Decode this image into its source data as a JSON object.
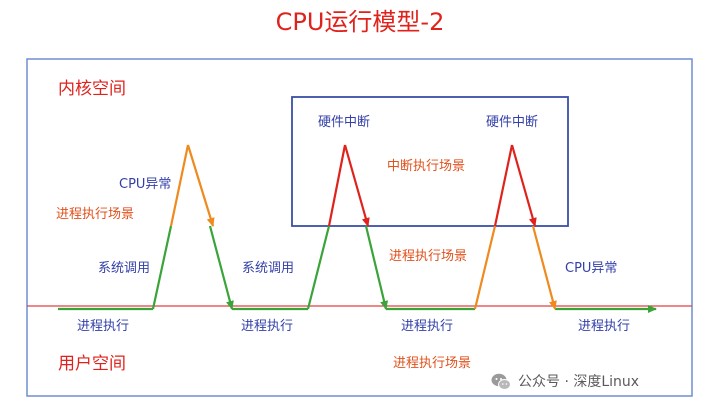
{
  "title": "CPU运行模型-2",
  "colors": {
    "title": "#e0221c",
    "region_label": "#e0221c",
    "frame": "#6f8fd0",
    "interrupt_box": "#3a4fa8",
    "baseline": "#e04040",
    "blue_text": "#3340a8",
    "orange_text": "#e0511c",
    "green_line": "#3aa33a",
    "orange_line": "#ef8a1e",
    "red_line": "#e0221c"
  },
  "regions": {
    "kernel": "内核空间",
    "user": "用户空间"
  },
  "labels": {
    "cpu_exception_left": "CPU异常",
    "process_scene_left": "进程执行场景",
    "syscall_1": "系统调用",
    "syscall_2": "系统调用",
    "hw_interrupt_1": "硬件中断",
    "hw_interrupt_2": "硬件中断",
    "interrupt_scene": "中断执行场景",
    "process_scene_mid": "进程执行场景",
    "cpu_exception_right": "CPU异常",
    "process_scene_bottom": "进程执行场景"
  },
  "process_labels": [
    "进程执行",
    "进程执行",
    "进程执行",
    "进程执行"
  ],
  "watermark": {
    "icon": "wechat-icon",
    "text": "公众号 · 深度Linux"
  }
}
